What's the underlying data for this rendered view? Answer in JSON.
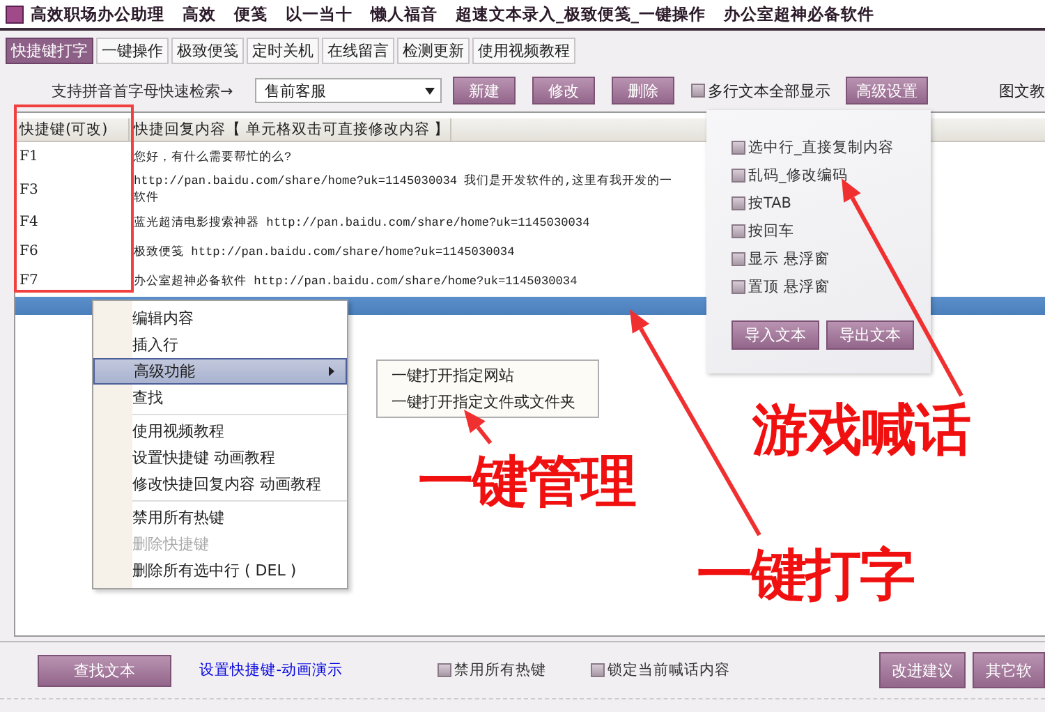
{
  "window": {
    "title_items": [
      "高效职场办公助理",
      "高效",
      "便笺",
      "以一当十",
      "懒人福音",
      "超速文本录入_极致便笺_一键操作",
      "办公室超神必备软件"
    ]
  },
  "tabs": [
    {
      "label": "快捷键打字",
      "selected": true
    },
    {
      "label": "一键操作",
      "selected": false
    },
    {
      "label": "极致便笺",
      "selected": false
    },
    {
      "label": "定时关机",
      "selected": false
    },
    {
      "label": "在线留言",
      "selected": false
    },
    {
      "label": "检测更新",
      "selected": false
    },
    {
      "label": "使用视频教程",
      "selected": false
    }
  ],
  "toolbar": {
    "search_hint": "支持拼音首字母快速检索→",
    "category": "售前客服",
    "buttons": [
      "新建",
      "修改",
      "删除"
    ],
    "multiline_checkbox": {
      "label": "多行文本全部显示",
      "checked": false
    },
    "advanced_button": "高级设置",
    "cut_link": "图文教"
  },
  "table": {
    "columns": [
      "快捷键(可改)",
      "快捷回复内容【 单元格双击可直接修改内容 】"
    ],
    "rows": [
      {
        "key": "F1",
        "lines": [
          "您好，有什么需要帮忙的么?"
        ]
      },
      {
        "key": "F3",
        "lines": [
          "http://pan.baidu.com/share/home?uk=1145030034  我们是开发软件的,这里有我开发的一",
          "软件"
        ]
      },
      {
        "key": "F4",
        "lines": [
          "蓝光超清电影搜索神器 http://pan.baidu.com/share/home?uk=1145030034"
        ]
      },
      {
        "key": "F6",
        "lines": [
          "极致便笺 http://pan.baidu.com/share/home?uk=1145030034"
        ]
      },
      {
        "key": "F7",
        "lines": [
          "办公室超神必备软件 http://pan.baidu.com/share/home?uk=1145030034"
        ]
      }
    ]
  },
  "settings_panel": {
    "options": [
      {
        "label": "选中行_直接复制内容",
        "checked": false
      },
      {
        "label": "乱码_修改编码",
        "checked": false
      },
      {
        "label": "按TAB",
        "checked": false
      },
      {
        "label": "按回车",
        "checked": false
      },
      {
        "label": "显示 悬浮窗",
        "checked": false
      },
      {
        "label": "置顶 悬浮窗",
        "checked": false
      }
    ],
    "buttons": [
      "导入文本",
      "导出文本"
    ]
  },
  "context_menu": {
    "groups": [
      [
        {
          "label": "编辑内容",
          "selected": false,
          "disabled": false,
          "has_submenu": false
        },
        {
          "label": "插入行",
          "selected": false,
          "disabled": false,
          "has_submenu": false
        },
        {
          "label": "高级功能",
          "selected": true,
          "disabled": false,
          "has_submenu": true
        },
        {
          "label": "查找",
          "selected": false,
          "disabled": false,
          "has_submenu": false
        }
      ],
      [
        {
          "label": "使用视频教程",
          "selected": false,
          "disabled": false,
          "has_submenu": false
        },
        {
          "label": "设置快捷键 动画教程",
          "selected": false,
          "disabled": false,
          "has_submenu": false
        },
        {
          "label": "修改快捷回复内容 动画教程",
          "selected": false,
          "disabled": false,
          "has_submenu": false
        }
      ],
      [
        {
          "label": "禁用所有热键",
          "selected": false,
          "disabled": false,
          "has_submenu": false
        },
        {
          "label": "删除快捷键",
          "selected": false,
          "disabled": true,
          "has_submenu": false
        },
        {
          "label": "删除所有选中行 ( DEL )",
          "selected": false,
          "disabled": false,
          "has_submenu": false
        }
      ]
    ]
  },
  "submenu": {
    "items": [
      "一键打开指定网站",
      "一键打开指定文件或文件夹"
    ]
  },
  "bottom_bar": {
    "find_button": "查找文本",
    "link": "设置快捷键-动画演示",
    "checkboxes": [
      {
        "label": "禁用所有热键",
        "checked": false
      },
      {
        "label": "锁定当前喊话内容",
        "checked": false
      }
    ],
    "buttons": [
      "改进建议",
      "其它软"
    ]
  },
  "annotations": [
    {
      "text": "一键打字"
    },
    {
      "text": "一键管理"
    },
    {
      "text": "游戏喊话"
    }
  ]
}
